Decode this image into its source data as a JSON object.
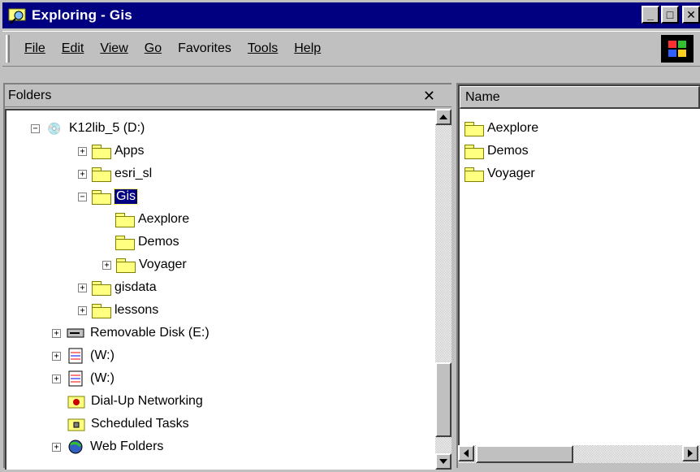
{
  "window": {
    "title": "Exploring - Gis",
    "minimize": "_",
    "maximize": "□",
    "close": "✕"
  },
  "menu": {
    "items": [
      "File",
      "Edit",
      "View",
      "Go",
      "Favorites",
      "Tools",
      "Help"
    ]
  },
  "folders": {
    "header": "Folders",
    "close": "✕",
    "tree": [
      {
        "label": "K12lib_5 (D:)"
      },
      {
        "label": "Apps"
      },
      {
        "label": "esri_sl"
      },
      {
        "label": "Gis"
      },
      {
        "label": "Aexplore"
      },
      {
        "label": "Demos"
      },
      {
        "label": "Voyager"
      },
      {
        "label": "gisdata"
      },
      {
        "label": "lessons"
      },
      {
        "label": "Removable Disk (E:)"
      },
      {
        "label": "(W:)"
      },
      {
        "label": "(W:)"
      },
      {
        "label": "Dial-Up Networking"
      },
      {
        "label": "Scheduled Tasks"
      },
      {
        "label": "Web Folders"
      }
    ]
  },
  "list": {
    "column": "Name",
    "items": [
      "Aexplore",
      "Demos",
      "Voyager"
    ]
  },
  "colors": {
    "titlebar": "#000080",
    "face": "#c0c0c0",
    "selection": "#000080",
    "folder": "#ffff80"
  }
}
